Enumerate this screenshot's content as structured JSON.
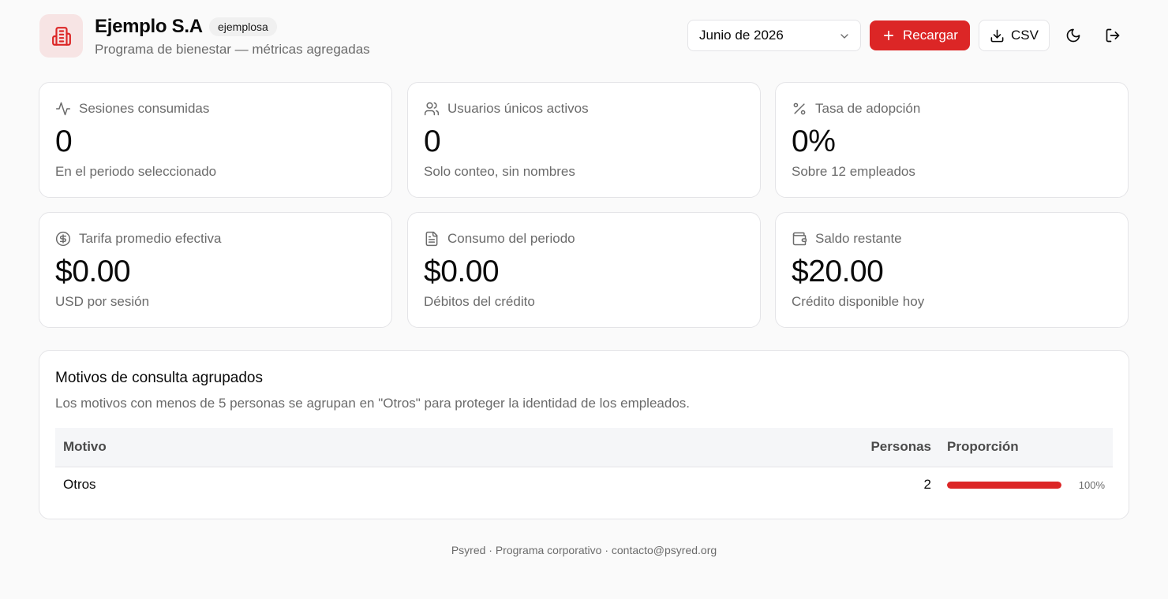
{
  "header": {
    "company_name": "Ejemplo S.A",
    "slug": "ejemplosa",
    "subtitle": "Programa de bienestar — métricas agregadas",
    "period_value": "Junio de 2026",
    "recargar_label": "Recargar",
    "csv_label": "CSV",
    "logo_icon": "building-icon",
    "accent_color": "#dc2626"
  },
  "metrics": [
    {
      "icon": "activity-icon",
      "label": "Sesiones consumidas",
      "value": "0",
      "note": "En el periodo seleccionado"
    },
    {
      "icon": "users-icon",
      "label": "Usuarios únicos activos",
      "value": "0",
      "note": "Solo conteo, sin nombres"
    },
    {
      "icon": "percent-icon",
      "label": "Tasa de adopción",
      "value": "0%",
      "note": "Sobre 12 empleados"
    },
    {
      "icon": "dollar-circle-icon",
      "label": "Tarifa promedio efectiva",
      "value": "$0.00",
      "note": "USD por sesión"
    },
    {
      "icon": "receipt-icon",
      "label": "Consumo del periodo",
      "value": "$0.00",
      "note": "Débitos del crédito"
    },
    {
      "icon": "wallet-icon",
      "label": "Saldo restante",
      "value": "$20.00",
      "note": "Crédito disponible hoy"
    }
  ],
  "reasons": {
    "title": "Motivos de consulta agrupados",
    "description": "Los motivos con menos de 5 personas se agrupan en \"Otros\" para proteger la identidad de los empleados.",
    "columns": [
      "Motivo",
      "Personas",
      "Proporción"
    ],
    "rows": [
      {
        "motivo": "Otros",
        "personas": "2",
        "proporcion_label": "100%",
        "proporcion": 1.0
      }
    ]
  },
  "footer": "Psyred · Programa corporativo · contacto@psyred.org"
}
